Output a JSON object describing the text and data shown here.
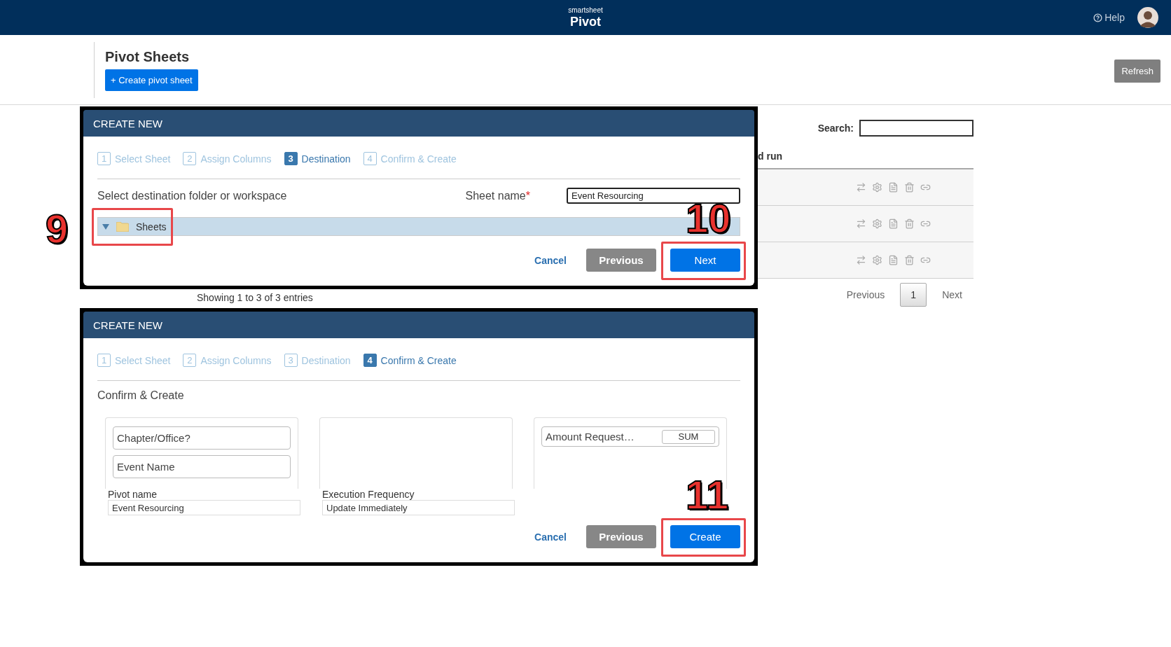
{
  "header": {
    "brand_small": "smartsheet",
    "brand": "Pivot",
    "help": "Help"
  },
  "page": {
    "title": "Pivot Sheets",
    "create_button": "+ Create pivot sheet",
    "refresh_button": "Refresh"
  },
  "table": {
    "search_label": "Search:",
    "columns": [
      "d run"
    ],
    "rows": [
      {
        "kind": "actions"
      },
      {
        "kind": "actions"
      },
      {
        "kind": "actions"
      }
    ],
    "entries_info": "Showing 1 to 3 of 3 entries",
    "pagination": {
      "previous": "Previous",
      "pages": [
        {
          "label": "1",
          "selected": true
        }
      ],
      "next": "Next"
    }
  },
  "dialogs": [
    {
      "title": "CREATE NEW",
      "kind": "destination",
      "steps": [
        {
          "number": "1",
          "label": "Select Sheet",
          "selected": false
        },
        {
          "number": "2",
          "label": "Assign Columns",
          "selected": false
        },
        {
          "number": "3",
          "label": "Destination",
          "selected": true
        },
        {
          "number": "4",
          "label": "Confirm & Create",
          "selected": false
        }
      ],
      "section_label": "Select destination folder or workspace",
      "sheet_name_label": "Sheet name",
      "required_mark": "*",
      "sheet_name_value": "Event Resourcing",
      "tree": [
        {
          "label": "Sheets",
          "expanded": true,
          "selected": true,
          "callout": "9"
        }
      ],
      "buttons": [
        {
          "label": "Cancel",
          "kind": "link"
        },
        {
          "label": "Previous",
          "kind": "secondary"
        },
        {
          "label": "Next",
          "kind": "primary",
          "callout": "10"
        }
      ]
    },
    {
      "title": "CREATE NEW",
      "kind": "confirm",
      "steps": [
        {
          "number": "1",
          "label": "Select Sheet",
          "selected": false
        },
        {
          "number": "2",
          "label": "Assign Columns",
          "selected": false
        },
        {
          "number": "3",
          "label": "Destination",
          "selected": false
        },
        {
          "number": "4",
          "label": "Confirm & Create",
          "selected": true
        }
      ],
      "section_label": "Confirm & Create",
      "panels": [
        {
          "kind": "columns",
          "chips": [
            {
              "label": "Chapter/Office?"
            },
            {
              "label": "Event Name"
            }
          ]
        },
        {
          "kind": "empty"
        },
        {
          "kind": "columns",
          "chips": [
            {
              "label": "Amount Request…",
              "aggregate": "SUM"
            }
          ]
        }
      ],
      "fields": [
        {
          "label": "Pivot name",
          "value": "Event Resourcing"
        },
        {
          "label": "Execution Frequency",
          "value": "Update Immediately"
        }
      ],
      "buttons": [
        {
          "label": "Cancel",
          "kind": "link"
        },
        {
          "label": "Previous",
          "kind": "secondary"
        },
        {
          "label": "Create",
          "kind": "primary",
          "callout": "11"
        }
      ]
    }
  ]
}
